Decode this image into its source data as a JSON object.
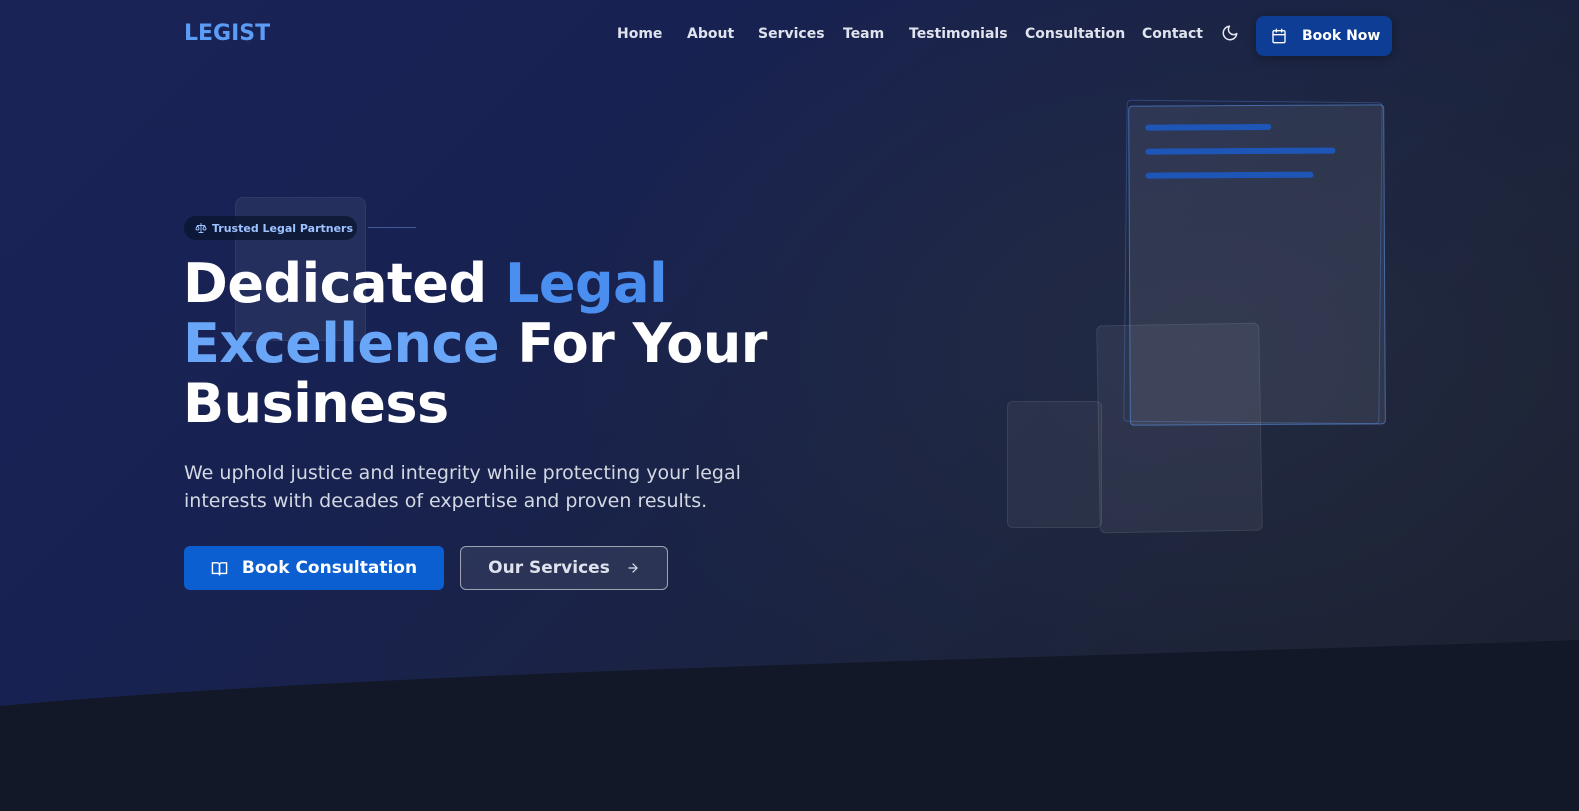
{
  "brand": {
    "logo": "LEGIST"
  },
  "nav": {
    "links": [
      "Home",
      "About",
      "Services",
      "Team",
      "Testimonials",
      "Consultation",
      "Contact"
    ],
    "cta_label": "Book Now",
    "theme_icon": "moon-icon"
  },
  "hero": {
    "badge": "Trusted Legal Partners",
    "badge_icon": "scales-icon",
    "headline": {
      "part1": "Dedicated ",
      "accent1": "Legal",
      "accent2": "Excellence",
      "part2": " For Your Business"
    },
    "subtext": "We uphold justice and integrity while protecting your legal interests with decades of expertise and proven results.",
    "primary_button": "Book Consultation",
    "primary_icon": "book-icon",
    "secondary_button": "Our Services",
    "secondary_icon": "arrow-right-icon"
  },
  "colors": {
    "accent": "#4a8ff0",
    "primary_button": "#0b5fd0",
    "nav_cta": "#0d3d94",
    "background": "#192356"
  }
}
